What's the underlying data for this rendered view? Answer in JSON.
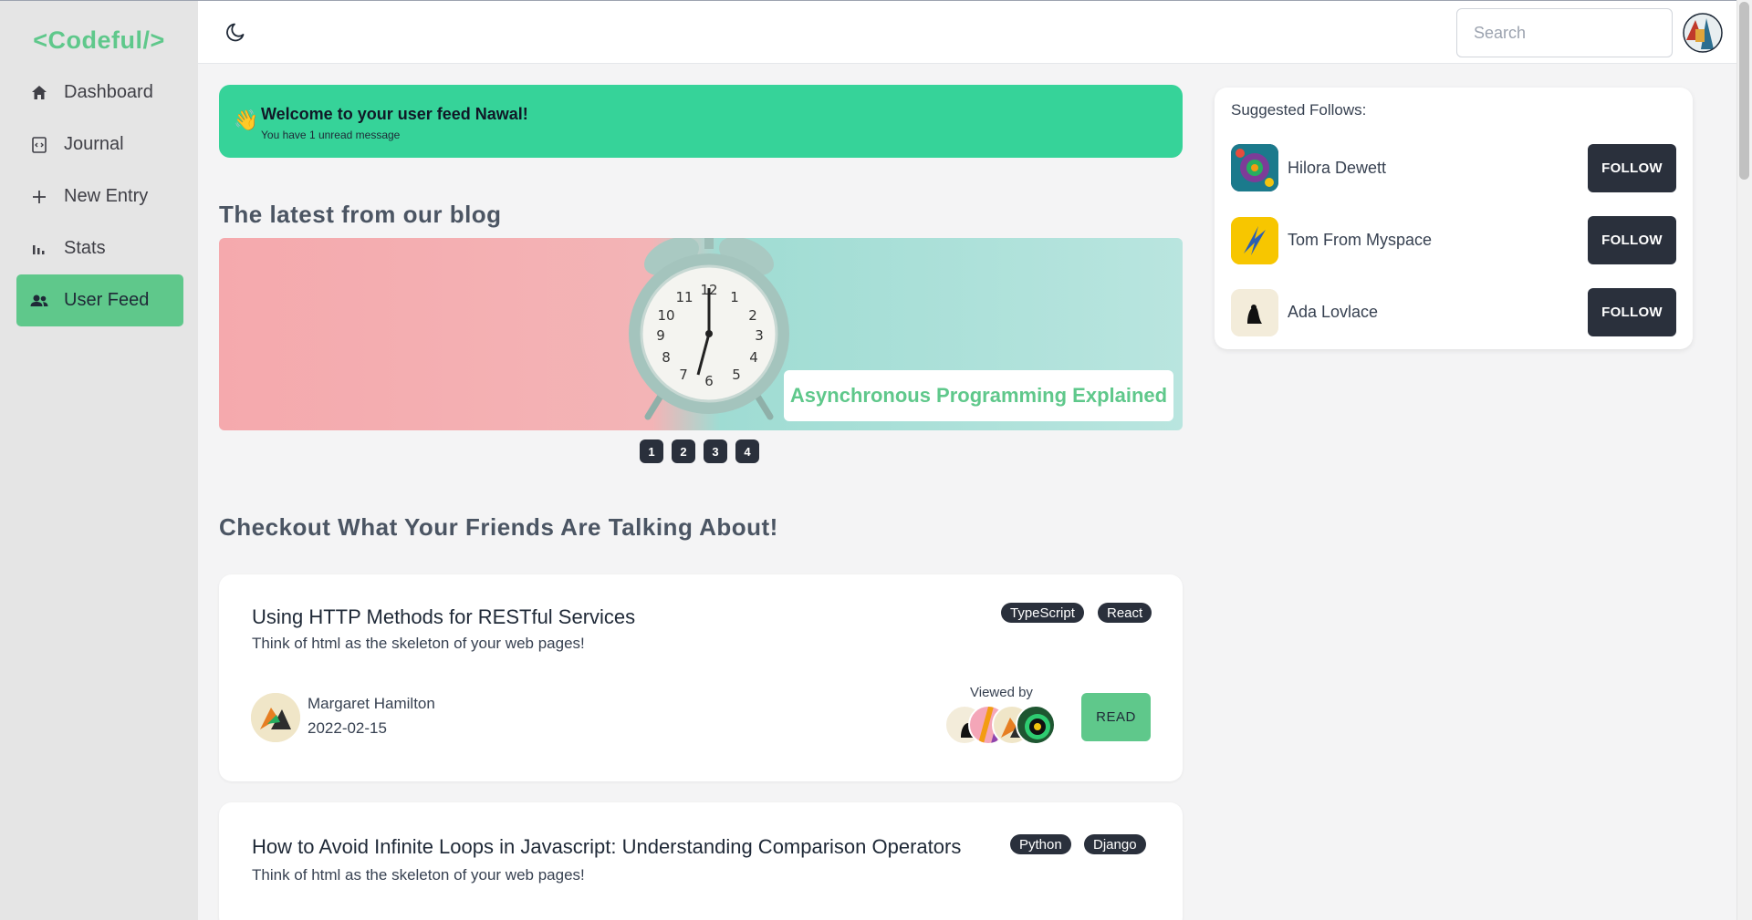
{
  "app": {
    "logo": "<Codeful/>"
  },
  "sidebar": {
    "items": [
      {
        "label": "Dashboard",
        "icon": "home-icon"
      },
      {
        "label": "Journal",
        "icon": "journal-icon"
      },
      {
        "label": "New Entry",
        "icon": "plus-icon"
      },
      {
        "label": "Stats",
        "icon": "bar-chart-icon"
      },
      {
        "label": "User Feed",
        "icon": "users-icon",
        "active": true
      }
    ]
  },
  "topbar": {
    "search_placeholder": "Search",
    "theme_icon": "moon-icon"
  },
  "welcome": {
    "title": "Welcome to your user feed Nawal!",
    "subtitle": "You have 1 unread message",
    "emoji": "👋"
  },
  "blog": {
    "heading": "The latest from our blog",
    "featured_title": "Asynchronous Programming Explained",
    "pages": [
      "1",
      "2",
      "3",
      "4"
    ]
  },
  "feed": {
    "heading": "Checkout What Your Friends Are Talking About!",
    "posts": [
      {
        "title": "Using HTTP Methods for RESTful Services",
        "subtitle": "Think of html as the skeleton of your web pages!",
        "tags": [
          "TypeScript",
          "React"
        ],
        "author": "Margaret Hamilton",
        "date": "2022-02-15",
        "viewed_label": "Viewed by",
        "read_label": "READ"
      },
      {
        "title": "How to Avoid Infinite Loops in Javascript: Understanding Comparison Operators",
        "subtitle": "Think of html as the skeleton of your web pages!",
        "tags": [
          "Python",
          "Django"
        ]
      }
    ]
  },
  "suggested": {
    "title": "Suggested Follows:",
    "follow_label": "FOLLOW",
    "users": [
      {
        "name": "Hilora Dewett"
      },
      {
        "name": "Tom From Myspace"
      },
      {
        "name": "Ada Lovlace"
      }
    ]
  },
  "colors": {
    "accent": "#5fc88b",
    "welcome": "#36d399",
    "dark": "#2a303c"
  }
}
